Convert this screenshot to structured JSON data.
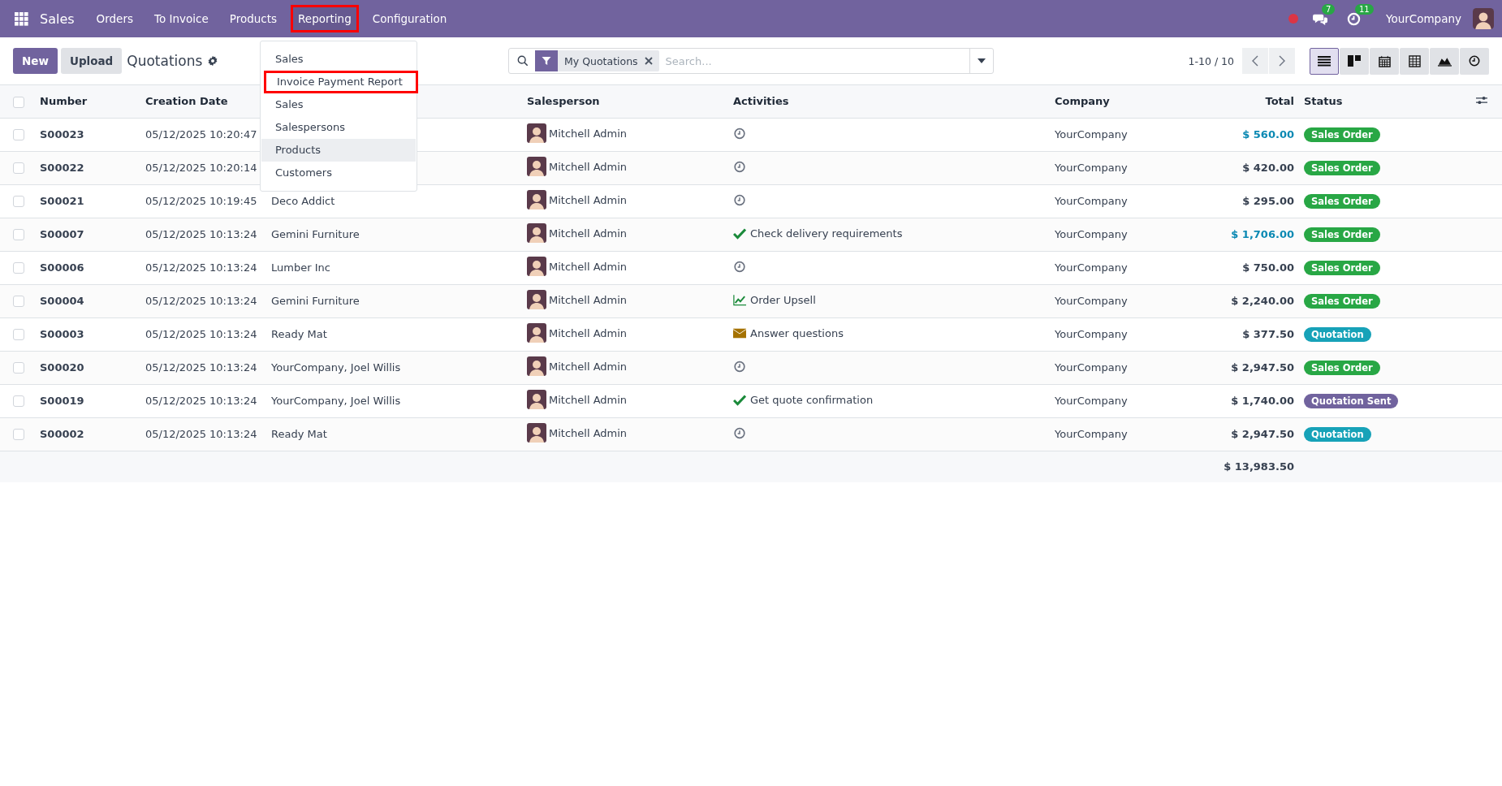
{
  "navbar": {
    "app_name": "Sales",
    "menu": [
      {
        "label": "Orders",
        "highlighted": false
      },
      {
        "label": "To Invoice",
        "highlighted": false
      },
      {
        "label": "Products",
        "highlighted": false
      },
      {
        "label": "Reporting",
        "highlighted": true
      },
      {
        "label": "Configuration",
        "highlighted": false
      }
    ],
    "messages_badge": "7",
    "activities_badge": "11",
    "company": "YourCompany"
  },
  "reporting_menu": [
    {
      "label": "Sales",
      "highlighted": false,
      "hovered": false
    },
    {
      "label": "Invoice Payment Report",
      "highlighted": true,
      "hovered": false
    },
    {
      "label": "Sales",
      "highlighted": false,
      "hovered": false
    },
    {
      "label": "Salespersons",
      "highlighted": false,
      "hovered": false
    },
    {
      "label": "Products",
      "highlighted": false,
      "hovered": true
    },
    {
      "label": "Customers",
      "highlighted": false,
      "hovered": false
    }
  ],
  "control_panel": {
    "new_button": "New",
    "upload_button": "Upload",
    "title": "Quotations",
    "filter_facet": "My Quotations",
    "search_placeholder": "Search...",
    "pager": "1-10 / 10",
    "views": [
      {
        "kind": "list",
        "selected": true
      },
      {
        "kind": "kanban",
        "selected": false
      },
      {
        "kind": "calendar",
        "selected": false
      },
      {
        "kind": "pivot",
        "selected": false
      },
      {
        "kind": "graph",
        "selected": false
      },
      {
        "kind": "activity",
        "selected": false
      }
    ]
  },
  "table": {
    "all_checked": false,
    "columns": [
      "Number",
      "Creation Date",
      "Salesperson",
      "Activities",
      "Company",
      "Total",
      "Status"
    ],
    "rows": [
      {
        "checked": false,
        "number": "S00023",
        "date": "05/12/2025 10:20:47",
        "salesperson": "Mitchell Admin",
        "activity": {
          "kind": "clock"
        },
        "company": "YourCompany",
        "total": "$ 560.00",
        "total_emphasized": true,
        "status": "Sales Order",
        "color": "#28a745"
      },
      {
        "checked": false,
        "number": "S00022",
        "date": "05/12/2025 10:20:14",
        "salesperson": "Mitchell Admin",
        "activity": {
          "kind": "clock"
        },
        "company": "YourCompany",
        "total": "$ 420.00",
        "total_emphasized": false,
        "status": "Sales Order",
        "color": "#28a745"
      },
      {
        "checked": false,
        "number": "S00021",
        "date": "05/12/2025 10:19:45",
        "customer": "Deco Addict",
        "salesperson": "Mitchell Admin",
        "activity": {
          "kind": "clock"
        },
        "company": "YourCompany",
        "total": "$ 295.00",
        "total_emphasized": false,
        "status": "Sales Order",
        "color": "#28a745"
      },
      {
        "checked": false,
        "number": "S00007",
        "date": "05/12/2025 10:13:24",
        "customer": "Gemini Furniture",
        "salesperson": "Mitchell Admin",
        "activity": {
          "kind": "check",
          "text": "Check delivery requirements"
        },
        "company": "YourCompany",
        "total": "$ 1,706.00",
        "total_emphasized": true,
        "status": "Sales Order",
        "color": "#28a745"
      },
      {
        "checked": false,
        "number": "S00006",
        "date": "05/12/2025 10:13:24",
        "customer": "Lumber Inc",
        "salesperson": "Mitchell Admin",
        "activity": {
          "kind": "clock"
        },
        "company": "YourCompany",
        "total": "$ 750.00",
        "total_emphasized": false,
        "status": "Sales Order",
        "color": "#28a745"
      },
      {
        "checked": false,
        "number": "S00004",
        "date": "05/12/2025 10:13:24",
        "customer": "Gemini Furniture",
        "salesperson": "Mitchell Admin",
        "activity": {
          "kind": "trend",
          "text": "Order Upsell"
        },
        "company": "YourCompany",
        "total": "$ 2,240.00",
        "total_emphasized": false,
        "status": "Sales Order",
        "color": "#28a745"
      },
      {
        "checked": false,
        "number": "S00003",
        "date": "05/12/2025 10:13:24",
        "customer": "Ready Mat",
        "salesperson": "Mitchell Admin",
        "activity": {
          "kind": "mail",
          "text": "Answer questions"
        },
        "company": "YourCompany",
        "total": "$ 377.50",
        "total_emphasized": false,
        "status": "Quotation",
        "color": "#17a2b8"
      },
      {
        "checked": false,
        "number": "S00020",
        "date": "05/12/2025 10:13:24",
        "customer": "YourCompany, Joel Willis",
        "salesperson": "Mitchell Admin",
        "activity": {
          "kind": "clock"
        },
        "company": "YourCompany",
        "total": "$ 2,947.50",
        "total_emphasized": false,
        "status": "Sales Order",
        "color": "#28a745"
      },
      {
        "checked": false,
        "number": "S00019",
        "date": "05/12/2025 10:13:24",
        "customer": "YourCompany, Joel Willis",
        "salesperson": "Mitchell Admin",
        "activity": {
          "kind": "check",
          "text": "Get quote confirmation"
        },
        "company": "YourCompany",
        "total": "$ 1,740.00",
        "total_emphasized": false,
        "status": "Quotation Sent",
        "color": "#71639e"
      },
      {
        "checked": false,
        "number": "S00002",
        "date": "05/12/2025 10:13:24",
        "customer": "Ready Mat",
        "salesperson": "Mitchell Admin",
        "activity": {
          "kind": "clock"
        },
        "company": "YourCompany",
        "total": "$ 2,947.50",
        "total_emphasized": false,
        "status": "Quotation",
        "color": "#17a2b8"
      }
    ],
    "grand_total": "$ 13,983.50"
  }
}
